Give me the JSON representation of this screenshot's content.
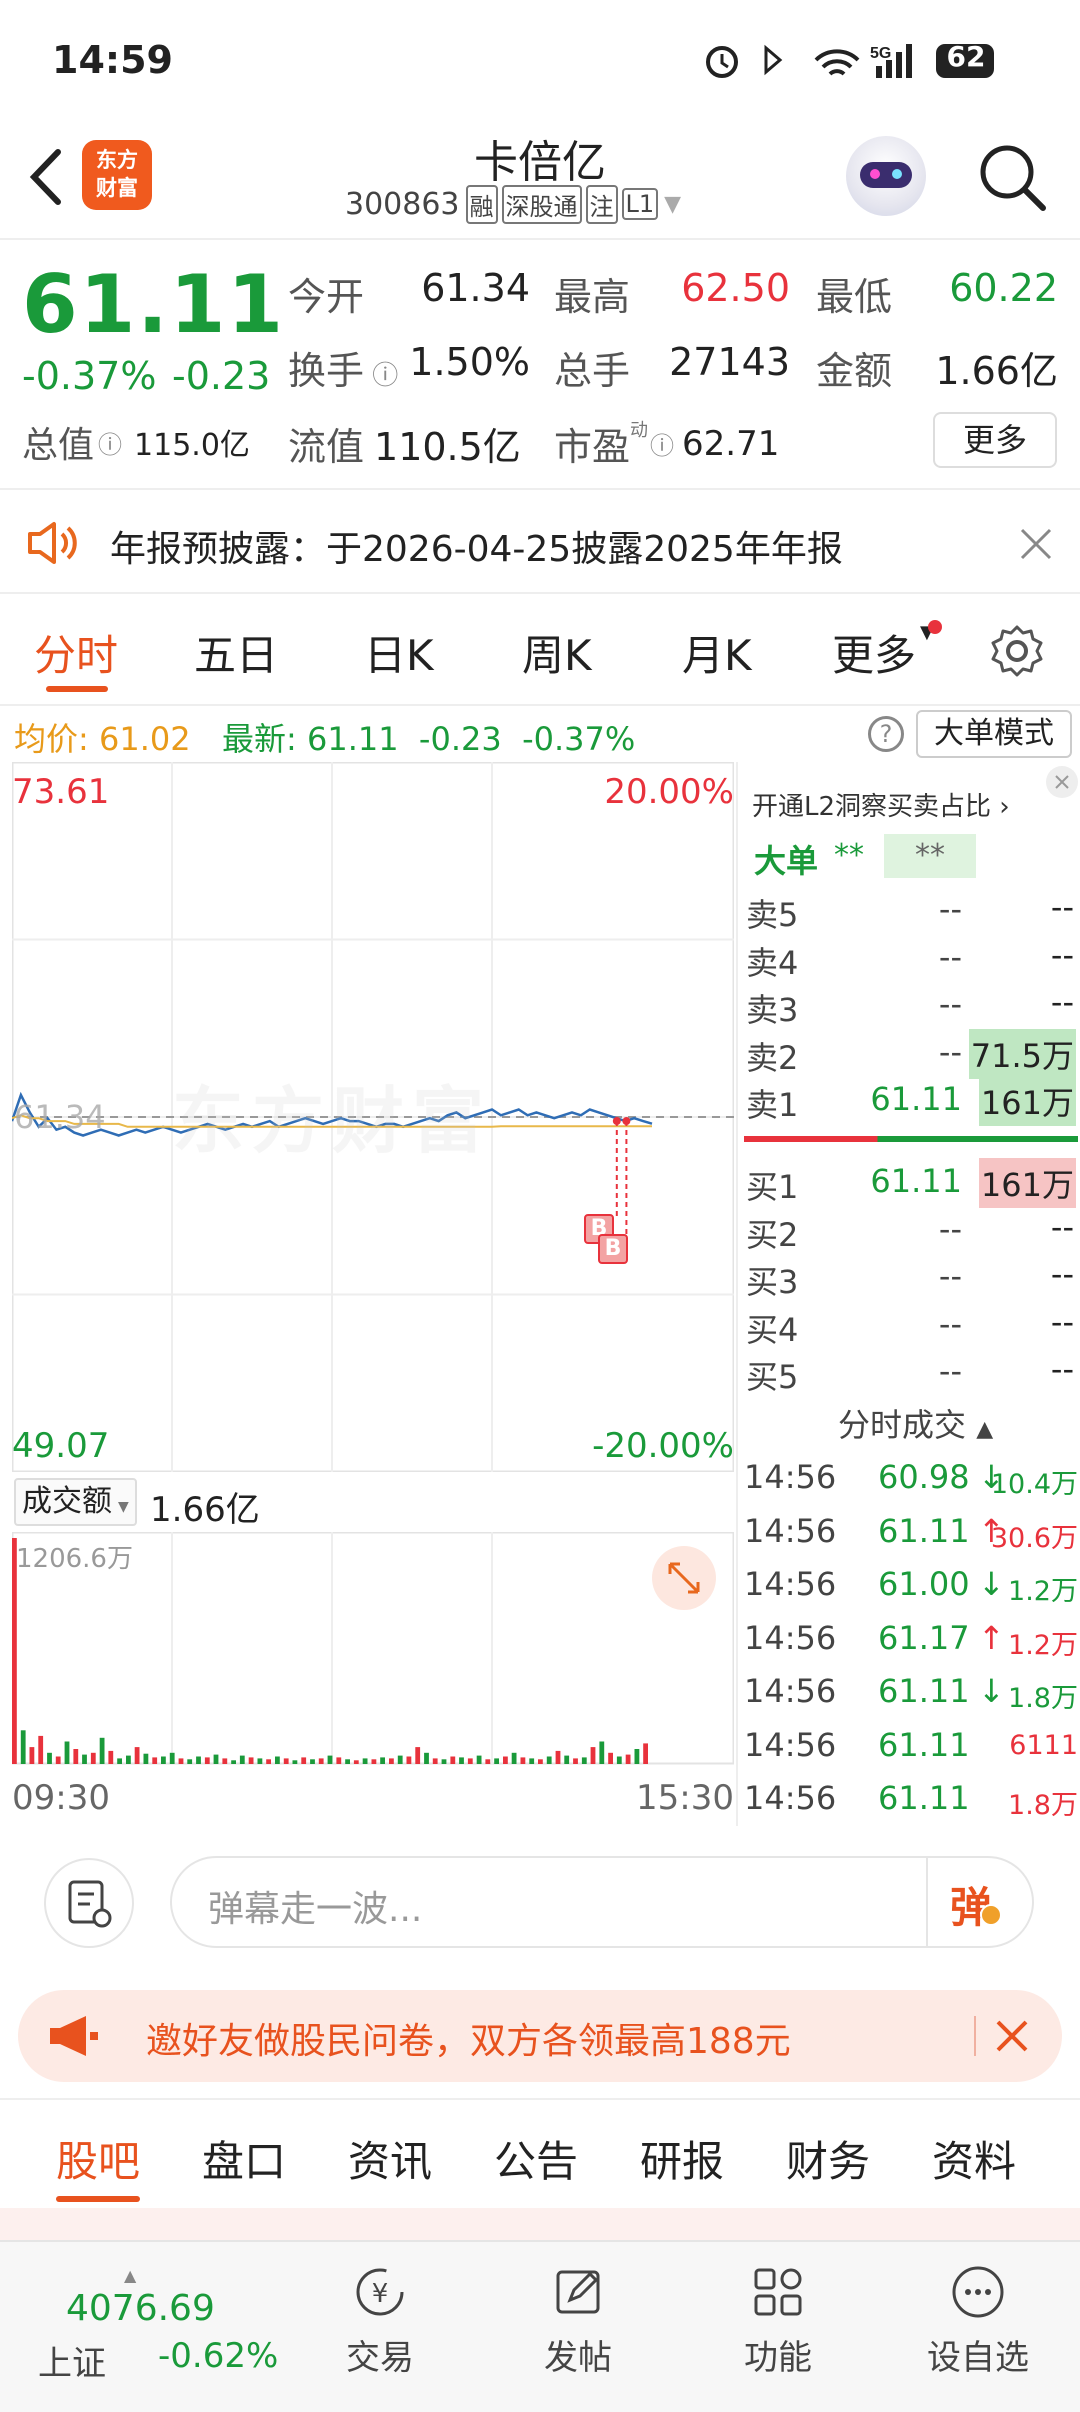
{
  "status_bar": {
    "time": "14:59",
    "battery": "62",
    "network": "5G"
  },
  "header": {
    "stock_name": "卡倍亿",
    "stock_code": "300863",
    "tags": [
      "融",
      "深股通",
      "注",
      "L1"
    ],
    "logo_line1": "东方",
    "logo_line2": "财富"
  },
  "quote": {
    "price": "61.11",
    "change_pct": "-0.37%",
    "change": "-0.23",
    "items": [
      {
        "label": "今开",
        "value": "61.34",
        "color": "#222"
      },
      {
        "label": "最高",
        "value": "62.50",
        "color": "#e8323c"
      },
      {
        "label": "最低",
        "value": "60.22",
        "color": "#1a9a3a"
      },
      {
        "label": "换手",
        "value": "1.50%",
        "color": "#222"
      },
      {
        "label": "总手",
        "value": "27143",
        "color": "#222"
      },
      {
        "label": "金额",
        "value": "1.66亿",
        "color": "#222"
      }
    ],
    "total_value_label": "总值",
    "total_value": "115.0亿",
    "float_value_label": "流值",
    "float_value": "110.5亿",
    "pe_label": "市盈",
    "pe_sup": "动",
    "pe_value": "62.71",
    "more_button": "更多"
  },
  "notice": {
    "text": "年报预披露：于2026-04-25披露2025年年报"
  },
  "tabs": [
    "分时",
    "五日",
    "日K",
    "周K",
    "月K",
    "更多"
  ],
  "info_line": {
    "avg_label": "均价:",
    "avg_value": "61.02",
    "latest_label": "最新:",
    "latest_value": "61.11",
    "change": "-0.23",
    "change_pct": "-0.37%",
    "mode_button": "大单模式"
  },
  "chart": {
    "y_top": "73.61",
    "y_bottom": "49.07",
    "pct_top": "20.00%",
    "pct_bottom": "-20.00%",
    "ref_price": "61.34",
    "watermark": "东方财富",
    "x_start": "09:30",
    "x_end": "15:30",
    "volume_selector": "成交额",
    "volume_total": "1.66亿",
    "volume_max_label": "1206.6万",
    "trade_markers": [
      "B",
      "B"
    ]
  },
  "chart_data": {
    "type": "line",
    "title": "",
    "ylim": [
      49.07,
      73.61
    ],
    "reference": 61.34,
    "series": [
      {
        "name": "price",
        "color": "#2f6db5",
        "values": [
          61.2,
          62.1,
          61.5,
          61.0,
          61.3,
          60.9,
          61.0,
          60.8,
          60.7,
          60.8,
          60.9,
          60.8,
          60.7,
          60.8,
          60.9,
          60.8,
          60.9,
          61.0,
          60.9,
          60.8,
          60.9,
          61.0,
          61.1,
          61.0,
          60.9,
          61.0,
          61.1,
          61.0,
          61.1,
          61.2,
          61.0,
          61.1,
          61.2,
          61.3,
          61.2,
          61.1,
          61.2,
          61.3,
          61.2,
          61.2,
          61.1,
          61.0,
          61.1,
          61.1,
          61.0,
          61.1,
          61.2,
          61.3,
          61.2,
          61.4,
          61.5,
          61.3,
          61.4,
          61.5,
          61.6,
          61.4,
          61.5,
          61.6,
          61.4,
          61.5,
          61.4,
          61.3,
          61.4,
          61.5,
          61.4,
          61.6,
          61.5,
          61.4,
          61.3,
          61.2,
          61.3,
          61.2,
          61.11
        ]
      },
      {
        "name": "均价",
        "color": "#e8b84a",
        "values": [
          61.3,
          61.4,
          61.3,
          61.3,
          61.2,
          61.2,
          61.2,
          61.1,
          61.1,
          61.1,
          61.1,
          61.1,
          61.1,
          61.0,
          61.0,
          61.0,
          61.0,
          61.0,
          61.0,
          61.0,
          61.0,
          61.0,
          61.0,
          61.0,
          61.0,
          61.0,
          61.0,
          61.0,
          61.0,
          61.0,
          61.0,
          61.0,
          61.0,
          61.0,
          61.0,
          61.0,
          61.0,
          61.0,
          61.0,
          61.0,
          61.0,
          61.0,
          61.0,
          61.0,
          61.0,
          61.0,
          61.0,
          61.0,
          61.0,
          61.0,
          61.0,
          61.0,
          61.0,
          61.0,
          61.0,
          61.02,
          61.02,
          61.02,
          61.02,
          61.02,
          61.02,
          61.02,
          61.02,
          61.02,
          61.02,
          61.02,
          61.02,
          61.02,
          61.02,
          61.02,
          61.02,
          61.02,
          61.02
        ]
      }
    ],
    "volume": {
      "max": 1206.6,
      "unit": "万",
      "values": [
        1206.6,
        180,
        90,
        150,
        60,
        40,
        120,
        80,
        50,
        60,
        140,
        70,
        30,
        45,
        90,
        55,
        35,
        40,
        60,
        30,
        25,
        40,
        35,
        50,
        30,
        20,
        45,
        35,
        30,
        25,
        40,
        30,
        20,
        35,
        25,
        30,
        45,
        35,
        25,
        20,
        30,
        25,
        35,
        30,
        45,
        40,
        90,
        60,
        30,
        25,
        40,
        35,
        30,
        45,
        25,
        30,
        40,
        60,
        35,
        30,
        25,
        40,
        70,
        45,
        30,
        35,
        90,
        120,
        60,
        40,
        50,
        80,
        110
      ],
      "colors": [
        "r",
        "g",
        "r",
        "r",
        "g",
        "r",
        "g",
        "r",
        "g",
        "r",
        "g",
        "r",
        "g",
        "g",
        "r",
        "g",
        "r",
        "g",
        "g",
        "r",
        "g",
        "g",
        "r",
        "g",
        "r",
        "g",
        "g",
        "r",
        "g",
        "r",
        "g",
        "r",
        "g",
        "r",
        "g",
        "r",
        "g",
        "r",
        "g",
        "r",
        "g",
        "r",
        "g",
        "r",
        "g",
        "r",
        "r",
        "g",
        "r",
        "g",
        "r",
        "g",
        "r",
        "g",
        "r",
        "g",
        "r",
        "g",
        "r",
        "g",
        "r",
        "g",
        "r",
        "g",
        "r",
        "g",
        "r",
        "g",
        "r",
        "g",
        "r",
        "g",
        "r"
      ]
    }
  },
  "order_book": {
    "promo": "开通L2洞察买卖占比",
    "big_order_label": "大单",
    "big_order_v1": "**",
    "big_order_v2": "**",
    "asks": [
      {
        "label": "卖5",
        "price": "--",
        "vol": "--"
      },
      {
        "label": "卖4",
        "price": "--",
        "vol": "--"
      },
      {
        "label": "卖3",
        "price": "--",
        "vol": "--"
      },
      {
        "label": "卖2",
        "price": "--",
        "vol": "71.5万"
      },
      {
        "label": "卖1",
        "price": "61.11",
        "vol": "161万"
      }
    ],
    "bids": [
      {
        "label": "买1",
        "price": "61.11",
        "vol": "161万"
      },
      {
        "label": "买2",
        "price": "--",
        "vol": "--"
      },
      {
        "label": "买3",
        "price": "--",
        "vol": "--"
      },
      {
        "label": "买4",
        "price": "--",
        "vol": "--"
      },
      {
        "label": "买5",
        "price": "--",
        "vol": "--"
      }
    ],
    "ticks_title": "分时成交",
    "ticks": [
      {
        "time": "14:56",
        "price": "60.98",
        "arrow": "↓",
        "vol": "10.4万",
        "dir": "down"
      },
      {
        "time": "14:56",
        "price": "61.11",
        "arrow": "↑",
        "vol": "30.6万",
        "dir": "up"
      },
      {
        "time": "14:56",
        "price": "61.00",
        "arrow": "↓",
        "vol": "1.2万",
        "dir": "down"
      },
      {
        "time": "14:56",
        "price": "61.17",
        "arrow": "↑",
        "vol": "1.2万",
        "dir": "up"
      },
      {
        "time": "14:56",
        "price": "61.11",
        "arrow": "↓",
        "vol": "1.8万",
        "dir": "down"
      },
      {
        "time": "14:56",
        "price": "61.11",
        "arrow": "",
        "vol": "6111",
        "dir": "up"
      },
      {
        "time": "14:56",
        "price": "61.11",
        "arrow": "",
        "vol": "1.8万",
        "dir": "up"
      }
    ]
  },
  "comment": {
    "placeholder": "弹幕走一波...",
    "danmu_button": "弹"
  },
  "invite": {
    "text": "邀好友做股民问卷，双方各领最高188元"
  },
  "bottom_tabs": [
    "股吧",
    "盘口",
    "资讯",
    "公告",
    "研报",
    "财务",
    "资料"
  ],
  "nav": {
    "index_value": "4076.69",
    "index_name": "上证",
    "index_change": "-0.62%",
    "items": [
      "交易",
      "发帖",
      "功能",
      "设自选"
    ]
  }
}
